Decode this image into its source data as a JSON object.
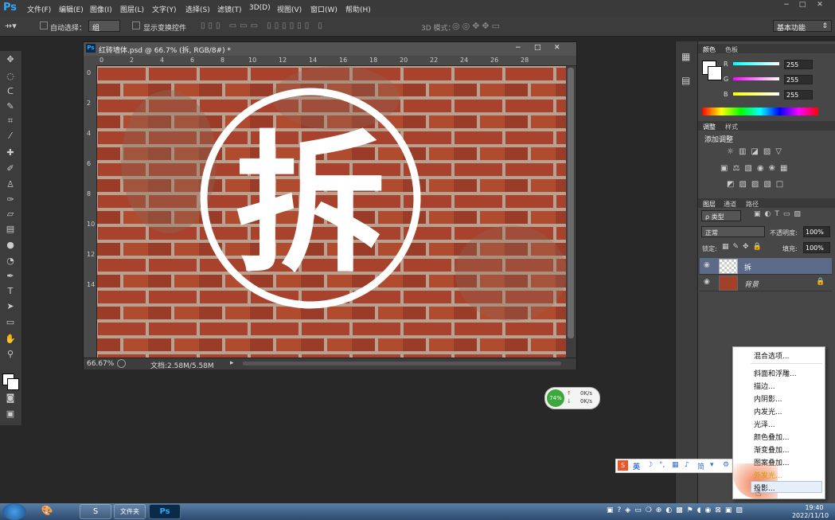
{
  "app": {
    "logo": "Ps"
  },
  "menubar": {
    "items": [
      "文件(F)",
      "编辑(E)",
      "图像(I)",
      "图层(L)",
      "文字(Y)",
      "选择(S)",
      "滤镜(T)",
      "3D(D)",
      "视图(V)",
      "窗口(W)",
      "帮助(H)"
    ],
    "window_controls": [
      "−",
      "□",
      "✕"
    ]
  },
  "options_bar": {
    "auto_select_label": "自动选择：",
    "auto_select_value": "组",
    "show_transform_label": "显示变换控件",
    "mode_3d_label": "3D 模式：",
    "workspace_value": "基本功能"
  },
  "document": {
    "tab_title": "红砖墙体.psd @ 66.7% (拆, RGB/8#) *",
    "canvas_text": "拆",
    "ruler_top_ticks": [
      "0",
      "2",
      "4",
      "6",
      "8",
      "10",
      "12",
      "14",
      "16",
      "18",
      "20",
      "22",
      "24",
      "26",
      "28"
    ],
    "ruler_left_ticks": [
      "0",
      "2",
      "4",
      "6",
      "8",
      "10",
      "12",
      "14"
    ],
    "zoom": "66.67%",
    "doc_info": "文档:2.58M/5.58M",
    "controls": [
      "−",
      "□",
      "✕"
    ]
  },
  "color_panel": {
    "tabs": [
      "颜色",
      "色板"
    ],
    "channels": [
      {
        "label": "R",
        "value": "255"
      },
      {
        "label": "G",
        "value": "255"
      },
      {
        "label": "B",
        "value": "255"
      }
    ]
  },
  "adjustments_panel": {
    "tabs": [
      "调整",
      "样式"
    ],
    "title": "添加调整"
  },
  "layers_panel": {
    "tabs": [
      "图层",
      "通道",
      "路径"
    ],
    "filter_kind": "ρ 类型",
    "blend_mode": "正常",
    "opacity_label": "不透明度:",
    "opacity_value": "100%",
    "lock_label": "锁定:",
    "fill_label": "填充:",
    "fill_value": "100%",
    "layers": [
      {
        "name": "拆",
        "selected": true
      },
      {
        "name": "背景",
        "selected": false
      }
    ]
  },
  "context_menu": {
    "items": [
      "混合选项...",
      "斜面和浮雕...",
      "描边...",
      "内阴影...",
      "内发光...",
      "光泽...",
      "颜色叠加...",
      "渐变叠加...",
      "图案叠加...",
      "外发光...",
      "投影..."
    ],
    "highlighted": "投影..."
  },
  "network_widget": {
    "percent": "74%",
    "up": "0K/s",
    "down": "0K/s"
  },
  "ime_bar": {
    "lang": "英",
    "mode": "简"
  },
  "taskbar": {
    "time": "19:40",
    "date": "2022/11/10",
    "apps": [
      "S",
      "文件夹",
      "Ps"
    ]
  },
  "colors": {
    "brick": "#a2402a",
    "mortar": "#c9b9a6",
    "panel": "#474747"
  }
}
